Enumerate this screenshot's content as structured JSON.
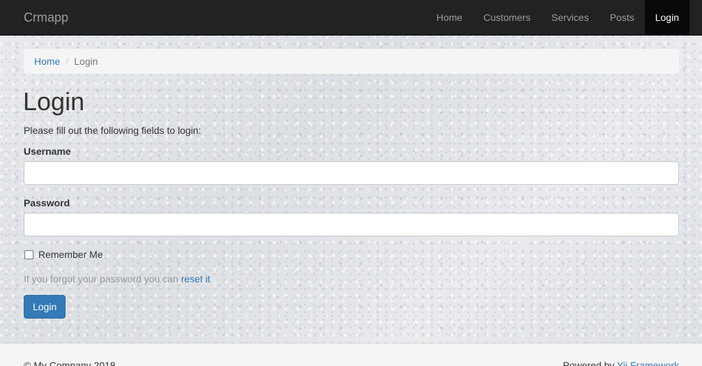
{
  "navbar": {
    "brand": "Crmapp",
    "items": [
      {
        "label": "Home",
        "active": false
      },
      {
        "label": "Customers",
        "active": false
      },
      {
        "label": "Services",
        "active": false
      },
      {
        "label": "Posts",
        "active": false
      },
      {
        "label": "Login",
        "active": true
      }
    ]
  },
  "breadcrumb": {
    "home": "Home",
    "separator": "/",
    "current": "Login"
  },
  "main": {
    "title": "Login",
    "intro": "Please fill out the following fields to login:",
    "username_label": "Username",
    "username_value": "",
    "password_label": "Password",
    "password_value": "",
    "remember_label": "Remember Me",
    "remember_checked": false,
    "forgot_text": "If you forgot your password you can",
    "reset_link": "reset it",
    "submit_label": "Login"
  },
  "footer": {
    "copyright": "© My Company 2018",
    "powered_text": "Powered by",
    "powered_link": "Yii Framework"
  },
  "colors": {
    "navbar_bg": "#222222",
    "link": "#337ab7",
    "button_primary": "#337ab7"
  }
}
